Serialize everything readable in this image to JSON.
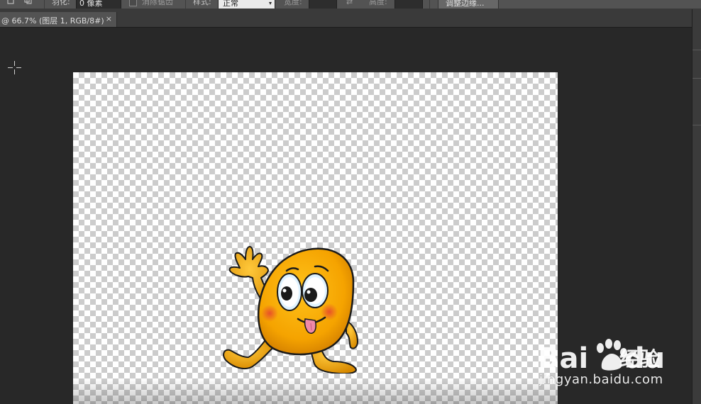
{
  "options_bar": {
    "feather_label": "羽化:",
    "feather_value": "0 像素",
    "antialias_label": "消除锯齿",
    "style_label": "样式:",
    "style_value": "正常",
    "width_label": "宽度:",
    "height_label": "高度:",
    "refine_edge_label": "调整边缘..."
  },
  "document_tab": {
    "title": "@ 66.7% (图层 1, RGB/8#)",
    "close_glyph": "×"
  },
  "canvas": {
    "content": "cartoon-mascot",
    "background": "transparent-checkerboard"
  },
  "watermark": {
    "brand": "Baidu 经验",
    "domain": "jingyan.baidu.com"
  },
  "colors": {
    "panel_bg": "#535353",
    "workspace_bg": "#282828",
    "mascot_body": "#f5a300",
    "cheek": "#e8502a"
  },
  "icons": {
    "tool_icon_1": "selection-new-icon",
    "tool_icon_2": "selection-add-icon",
    "swap_icon": "swap-arrow-icon",
    "cursor": "crosshair-icon"
  }
}
